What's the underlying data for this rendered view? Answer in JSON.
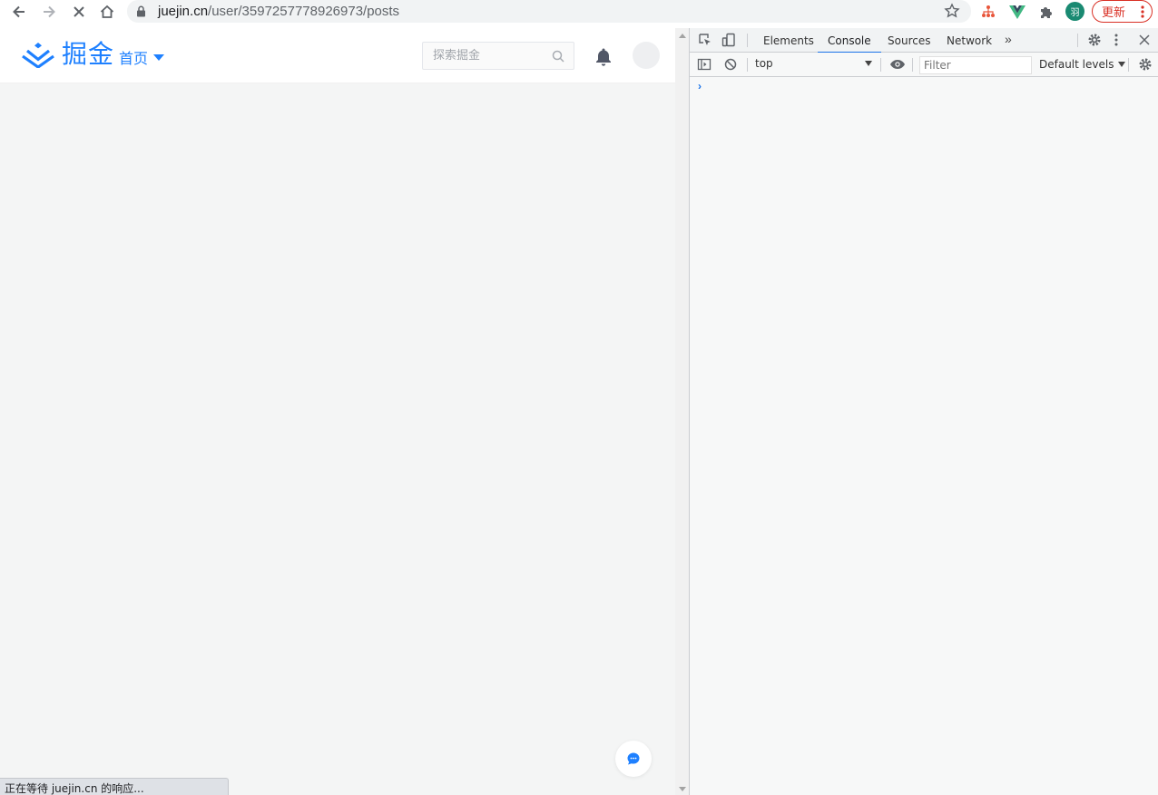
{
  "browser": {
    "url_host": "juejin.cn",
    "url_path": "/user/3597257778926973/posts",
    "profile_initial": "羽",
    "update_label": "更新",
    "status_text": "正在等待 juejin.cn 的响应..."
  },
  "site": {
    "logo_text": "掘金",
    "nav_home_label": "首页",
    "search_placeholder": "探索掘金",
    "brand_color": "#1e80ff"
  },
  "devtools": {
    "tabs": [
      {
        "label": "Elements",
        "active": false
      },
      {
        "label": "Console",
        "active": true
      },
      {
        "label": "Sources",
        "active": false
      },
      {
        "label": "Network",
        "active": false
      }
    ],
    "more_tabs": "»",
    "context": "top",
    "filter_placeholder": "Filter",
    "levels_label": "Default levels",
    "prompt": "›"
  },
  "icons": [
    "back-icon",
    "forward-icon",
    "stop-icon",
    "home-icon",
    "lock-icon",
    "star-icon",
    "extension-icon",
    "vue-icon",
    "puzzle-icon",
    "kebab-icon",
    "search-icon",
    "bell-icon",
    "chat-icon",
    "inspect-icon",
    "device-icon",
    "gear-icon",
    "close-icon",
    "sidebar-icon",
    "clear-icon",
    "eye-icon"
  ]
}
